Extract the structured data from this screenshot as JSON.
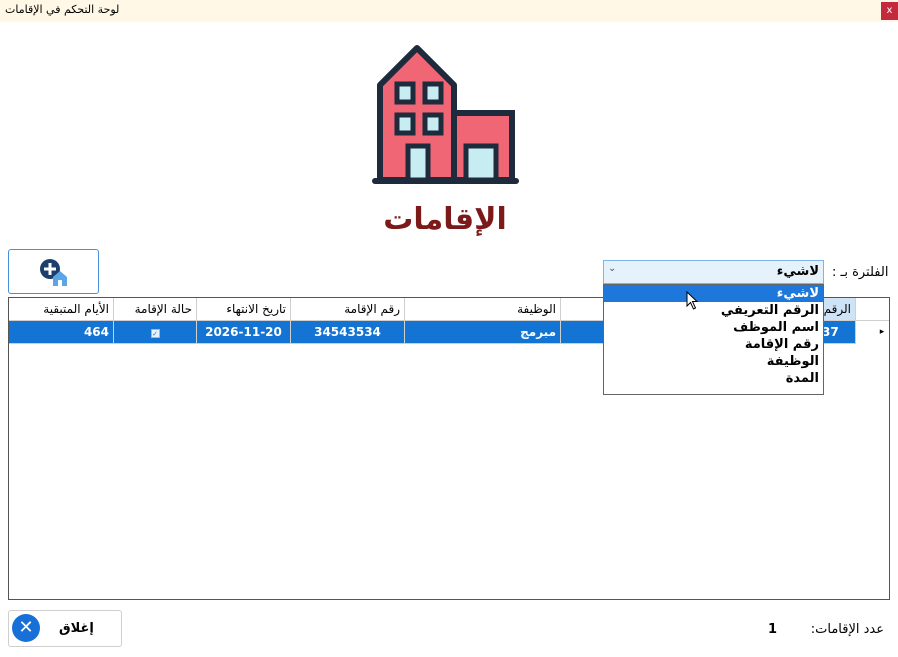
{
  "window": {
    "title": "لوحة التحكم في الإقامات",
    "close_glyph": "x"
  },
  "page": {
    "heading": "الإقامات"
  },
  "filter": {
    "label": "الفلترة بـ :",
    "selected": "لاشيء",
    "options": [
      "لاشيء",
      "الرقم التعريفي",
      "اسم الموظف",
      "رقم الإقامة",
      "الوظيفة",
      "المدة"
    ]
  },
  "table": {
    "columns": [
      "الأيام المتبقية",
      "حالة الإقامة",
      "تاريخ الانتهاء",
      "رقم الإقامة",
      "الوظيفة",
      "الرقم"
    ],
    "rows": [
      {
        "days_remaining": "464",
        "status_checked": "✓",
        "expiry": "2026-11-20",
        "residence_no": "34543534",
        "job": "مبرمج",
        "id": "37"
      }
    ]
  },
  "footer": {
    "close_label": "إغلاق",
    "count_label": "عدد الإقامات:",
    "count_value": "1"
  },
  "colors": {
    "accent": "#1474d4",
    "heading": "#7c1a1a",
    "house_red": "#f06675"
  }
}
